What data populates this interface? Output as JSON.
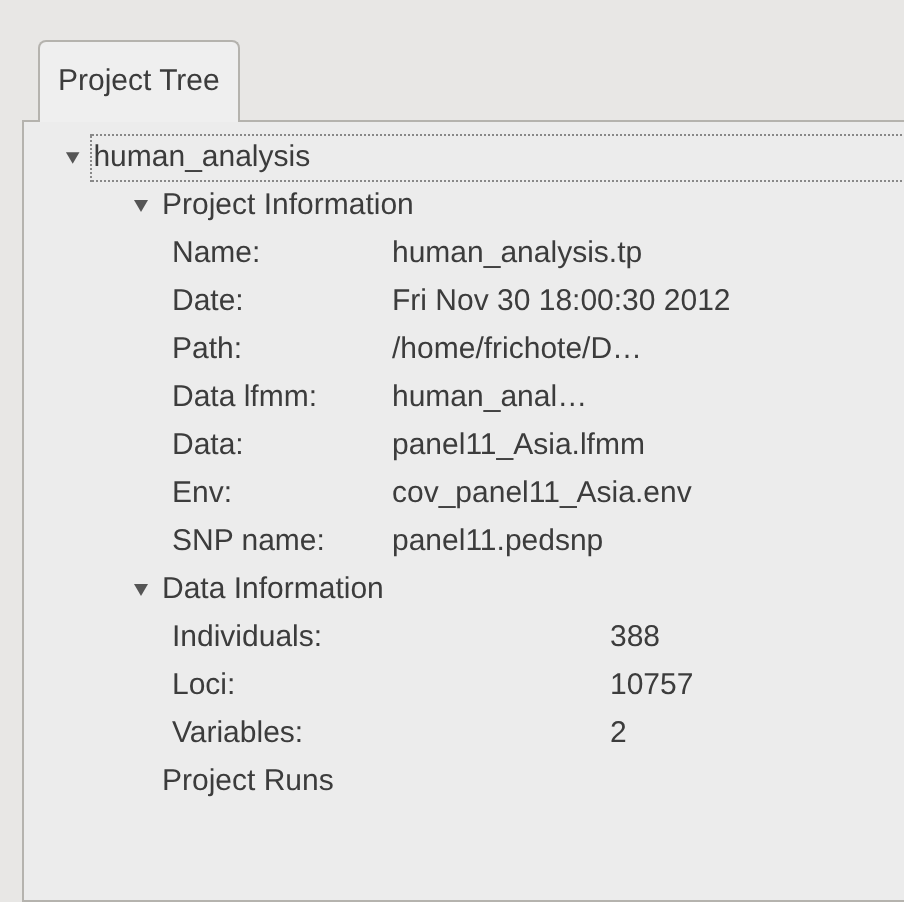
{
  "tabs": [
    {
      "label": "Project Tree",
      "selected": true
    }
  ],
  "tree": [
    {
      "label": "human_analysis",
      "expanded": true,
      "focused": true,
      "children": [
        {
          "label": "Project Information",
          "expanded": true,
          "children": [
            {
              "kind": "info-field",
              "label": "Name:",
              "value": "human_analysis.tp"
            },
            {
              "kind": "info-field",
              "label": "Date:",
              "value": "Fri Nov 30 18:00:30 2012"
            },
            {
              "kind": "info-field",
              "label": "Path:",
              "value": "/home/frichote/D…"
            },
            {
              "kind": "info-field",
              "label": "Data lfmm:",
              "value": "human_anal…"
            },
            {
              "kind": "info-field",
              "label": "Data:",
              "value": "panel11_Asia.lfmm"
            },
            {
              "kind": "info-field",
              "label": "Env:",
              "value": "cov_panel11_Asia.env"
            },
            {
              "kind": "info-field",
              "label": "SNP name:",
              "value": "panel11.pedsnp"
            }
          ]
        },
        {
          "label": "Data Information",
          "expanded": true,
          "children": [
            {
              "kind": "data-field",
              "label": "Individuals:",
              "value": "388"
            },
            {
              "kind": "data-field",
              "label": "Loci:",
              "value": "10757"
            },
            {
              "kind": "data-field",
              "label": "Variables:",
              "value": "2"
            }
          ]
        },
        {
          "label": "Project Runs",
          "expanded": false
        }
      ]
    }
  ]
}
